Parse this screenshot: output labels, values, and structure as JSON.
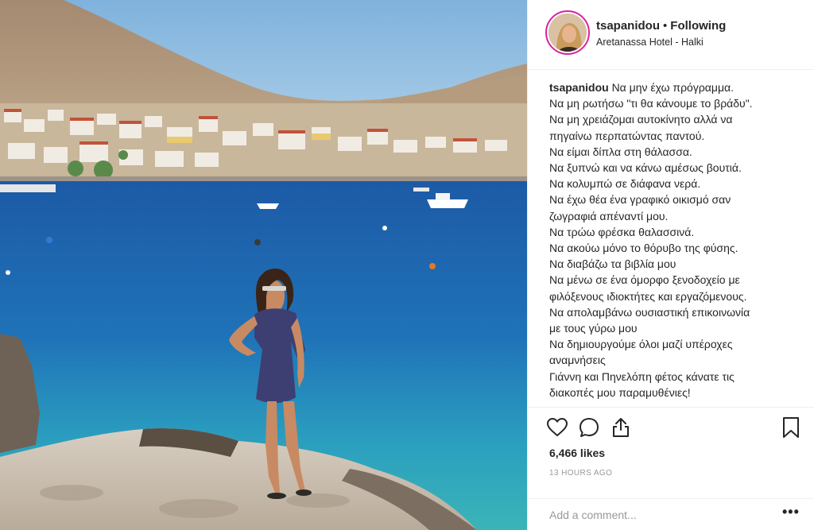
{
  "header": {
    "username": "tsapanidou",
    "separator": "•",
    "follow_status": "Following",
    "location": "Aretanassa Hotel - Halki"
  },
  "caption": {
    "username": "tsapanidou",
    "lines": [
      "Να μην έχω πρόγραμμα.",
      "Να μη ρωτήσω \"τι θα κάνουμε το βράδυ\".",
      "Να μη χρειάζομαι αυτοκίνητο αλλά να",
      "πηγαίνω περπατώντας παντού.",
      "Να είμαι δίπλα στη θάλασσα.",
      "Να ξυπνώ και να κάνω αμέσως βουτιά.",
      "Να κολυμπώ σε διάφανα νερά.",
      "Να έχω θέα ένα γραφικό οικισμό σαν",
      "ζωγραφιά απέναντί μου.",
      "Να τρώω φρέσκα θαλασσινά.",
      "Να ακούω μόνο το θόρυβο της φύσης.",
      "Να διαβάζω τα βιβλία μου",
      "Να μένω σε ένα όμορφο ξενοδοχείο με",
      "φιλόξενους ιδιοκτήτες και εργαζόμενους.",
      "Να απολαμβάνω ουσιαστική επικοινωνία",
      "με τους γύρω μου",
      "Να δημιουργούμε όλοι μαζί υπέροχες",
      "αναμνήσεις",
      "Γιάννη και Πηνελόπη φέτος κάνατε τις",
      "διακοπές μου παραμυθένιες!"
    ]
  },
  "actions": {
    "likes": "6,466 likes",
    "time": "13 HOURS AGO",
    "comment_placeholder": "Add a comment...",
    "more_label": "•••"
  },
  "icons": {
    "like": "heart-icon",
    "comment": "comment-bubble-icon",
    "share": "share-icon",
    "save": "bookmark-icon"
  },
  "colors": {
    "text": "#262626",
    "muted": "#999999",
    "border": "#efefef",
    "story_ring": "#d6249f"
  }
}
